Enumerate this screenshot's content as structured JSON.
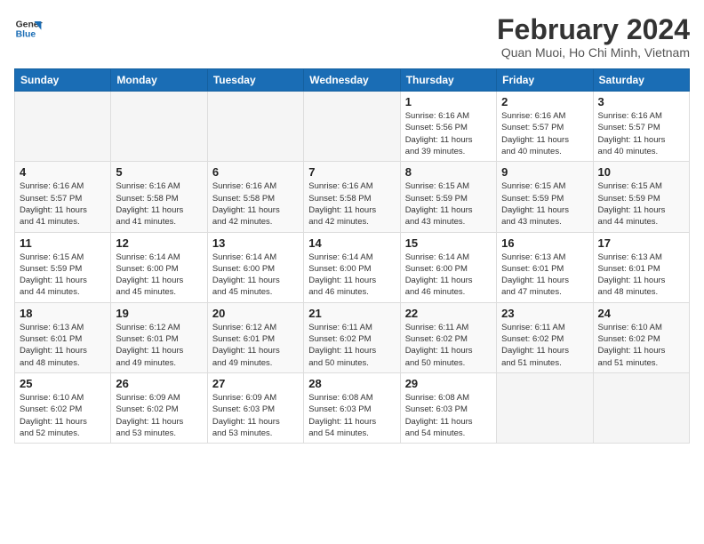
{
  "logo": {
    "line1": "General",
    "line2": "Blue"
  },
  "title": "February 2024",
  "subtitle": "Quan Muoi, Ho Chi Minh, Vietnam",
  "days_header": [
    "Sunday",
    "Monday",
    "Tuesday",
    "Wednesday",
    "Thursday",
    "Friday",
    "Saturday"
  ],
  "weeks": [
    [
      {
        "day": "",
        "info": ""
      },
      {
        "day": "",
        "info": ""
      },
      {
        "day": "",
        "info": ""
      },
      {
        "day": "",
        "info": ""
      },
      {
        "day": "1",
        "info": "Sunrise: 6:16 AM\nSunset: 5:56 PM\nDaylight: 11 hours\nand 39 minutes."
      },
      {
        "day": "2",
        "info": "Sunrise: 6:16 AM\nSunset: 5:57 PM\nDaylight: 11 hours\nand 40 minutes."
      },
      {
        "day": "3",
        "info": "Sunrise: 6:16 AM\nSunset: 5:57 PM\nDaylight: 11 hours\nand 40 minutes."
      }
    ],
    [
      {
        "day": "4",
        "info": "Sunrise: 6:16 AM\nSunset: 5:57 PM\nDaylight: 11 hours\nand 41 minutes."
      },
      {
        "day": "5",
        "info": "Sunrise: 6:16 AM\nSunset: 5:58 PM\nDaylight: 11 hours\nand 41 minutes."
      },
      {
        "day": "6",
        "info": "Sunrise: 6:16 AM\nSunset: 5:58 PM\nDaylight: 11 hours\nand 42 minutes."
      },
      {
        "day": "7",
        "info": "Sunrise: 6:16 AM\nSunset: 5:58 PM\nDaylight: 11 hours\nand 42 minutes."
      },
      {
        "day": "8",
        "info": "Sunrise: 6:15 AM\nSunset: 5:59 PM\nDaylight: 11 hours\nand 43 minutes."
      },
      {
        "day": "9",
        "info": "Sunrise: 6:15 AM\nSunset: 5:59 PM\nDaylight: 11 hours\nand 43 minutes."
      },
      {
        "day": "10",
        "info": "Sunrise: 6:15 AM\nSunset: 5:59 PM\nDaylight: 11 hours\nand 44 minutes."
      }
    ],
    [
      {
        "day": "11",
        "info": "Sunrise: 6:15 AM\nSunset: 5:59 PM\nDaylight: 11 hours\nand 44 minutes."
      },
      {
        "day": "12",
        "info": "Sunrise: 6:14 AM\nSunset: 6:00 PM\nDaylight: 11 hours\nand 45 minutes."
      },
      {
        "day": "13",
        "info": "Sunrise: 6:14 AM\nSunset: 6:00 PM\nDaylight: 11 hours\nand 45 minutes."
      },
      {
        "day": "14",
        "info": "Sunrise: 6:14 AM\nSunset: 6:00 PM\nDaylight: 11 hours\nand 46 minutes."
      },
      {
        "day": "15",
        "info": "Sunrise: 6:14 AM\nSunset: 6:00 PM\nDaylight: 11 hours\nand 46 minutes."
      },
      {
        "day": "16",
        "info": "Sunrise: 6:13 AM\nSunset: 6:01 PM\nDaylight: 11 hours\nand 47 minutes."
      },
      {
        "day": "17",
        "info": "Sunrise: 6:13 AM\nSunset: 6:01 PM\nDaylight: 11 hours\nand 48 minutes."
      }
    ],
    [
      {
        "day": "18",
        "info": "Sunrise: 6:13 AM\nSunset: 6:01 PM\nDaylight: 11 hours\nand 48 minutes."
      },
      {
        "day": "19",
        "info": "Sunrise: 6:12 AM\nSunset: 6:01 PM\nDaylight: 11 hours\nand 49 minutes."
      },
      {
        "day": "20",
        "info": "Sunrise: 6:12 AM\nSunset: 6:01 PM\nDaylight: 11 hours\nand 49 minutes."
      },
      {
        "day": "21",
        "info": "Sunrise: 6:11 AM\nSunset: 6:02 PM\nDaylight: 11 hours\nand 50 minutes."
      },
      {
        "day": "22",
        "info": "Sunrise: 6:11 AM\nSunset: 6:02 PM\nDaylight: 11 hours\nand 50 minutes."
      },
      {
        "day": "23",
        "info": "Sunrise: 6:11 AM\nSunset: 6:02 PM\nDaylight: 11 hours\nand 51 minutes."
      },
      {
        "day": "24",
        "info": "Sunrise: 6:10 AM\nSunset: 6:02 PM\nDaylight: 11 hours\nand 51 minutes."
      }
    ],
    [
      {
        "day": "25",
        "info": "Sunrise: 6:10 AM\nSunset: 6:02 PM\nDaylight: 11 hours\nand 52 minutes."
      },
      {
        "day": "26",
        "info": "Sunrise: 6:09 AM\nSunset: 6:02 PM\nDaylight: 11 hours\nand 53 minutes."
      },
      {
        "day": "27",
        "info": "Sunrise: 6:09 AM\nSunset: 6:03 PM\nDaylight: 11 hours\nand 53 minutes."
      },
      {
        "day": "28",
        "info": "Sunrise: 6:08 AM\nSunset: 6:03 PM\nDaylight: 11 hours\nand 54 minutes."
      },
      {
        "day": "29",
        "info": "Sunrise: 6:08 AM\nSunset: 6:03 PM\nDaylight: 11 hours\nand 54 minutes."
      },
      {
        "day": "",
        "info": ""
      },
      {
        "day": "",
        "info": ""
      }
    ]
  ]
}
